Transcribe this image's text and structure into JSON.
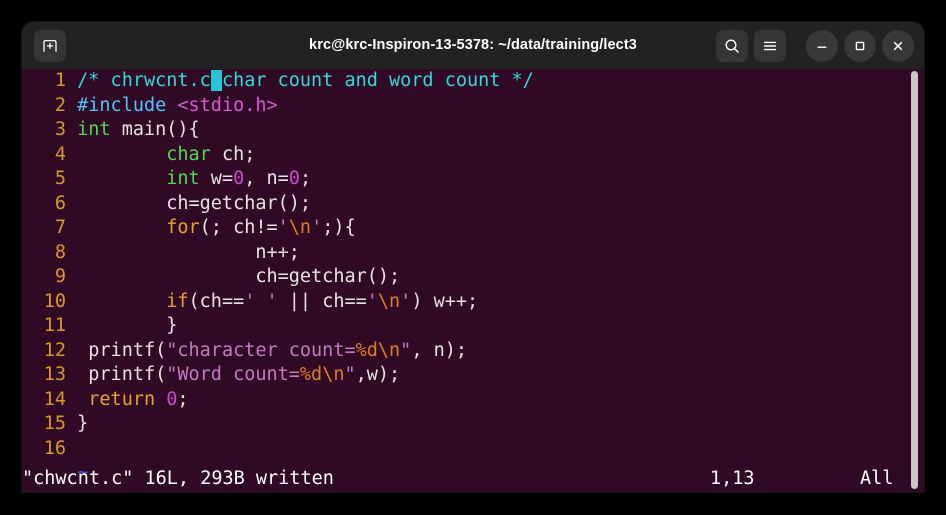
{
  "window": {
    "title": "krc@krc-Inspiron-13-5378: ~/data/training/lect3",
    "background_color": "#300a24",
    "titlebar_color": "#222222"
  },
  "titlebar": {
    "new_tab_label": "new-tab",
    "search_label": "search",
    "menu_label": "menu",
    "minimize_label": "minimize",
    "maximize_label": "maximize",
    "close_label": "close"
  },
  "editor": {
    "lines": [
      {
        "number": "1",
        "spans": [
          {
            "text": "/* chrwcnt.c",
            "class": "c-comment"
          },
          {
            "text": " ",
            "class": "cursor"
          },
          {
            "text": "char count and word count */",
            "class": "c-comment"
          }
        ]
      },
      {
        "number": "2",
        "spans": [
          {
            "text": "#include ",
            "class": "c-preproc"
          },
          {
            "text": "<stdio.h>",
            "class": "c-include"
          }
        ]
      },
      {
        "number": "3",
        "spans": [
          {
            "text": "int",
            "class": "c-type"
          },
          {
            "text": " main(){",
            "class": "c-plain"
          }
        ]
      },
      {
        "number": "4",
        "spans": [
          {
            "text": "        ",
            "class": "c-plain"
          },
          {
            "text": "char",
            "class": "c-type"
          },
          {
            "text": " ch;",
            "class": "c-plain"
          }
        ]
      },
      {
        "number": "5",
        "spans": [
          {
            "text": "        ",
            "class": "c-plain"
          },
          {
            "text": "int",
            "class": "c-type"
          },
          {
            "text": " w=",
            "class": "c-plain"
          },
          {
            "text": "0",
            "class": "c-num"
          },
          {
            "text": ", n=",
            "class": "c-plain"
          },
          {
            "text": "0",
            "class": "c-num"
          },
          {
            "text": ";",
            "class": "c-plain"
          }
        ]
      },
      {
        "number": "6",
        "spans": [
          {
            "text": "        ch=getchar();",
            "class": "c-plain"
          }
        ]
      },
      {
        "number": "7",
        "spans": [
          {
            "text": "        ",
            "class": "c-plain"
          },
          {
            "text": "for",
            "class": "c-kw"
          },
          {
            "text": "(; ch!=",
            "class": "c-plain"
          },
          {
            "text": "'",
            "class": "c-str"
          },
          {
            "text": "\\n",
            "class": "c-esc"
          },
          {
            "text": "'",
            "class": "c-str"
          },
          {
            "text": ";){",
            "class": "c-plain"
          }
        ]
      },
      {
        "number": "8",
        "spans": [
          {
            "text": "                n++;",
            "class": "c-plain"
          }
        ]
      },
      {
        "number": "9",
        "spans": [
          {
            "text": "                ch=getchar();",
            "class": "c-plain"
          }
        ]
      },
      {
        "number": "10",
        "spans": [
          {
            "text": "        ",
            "class": "c-plain"
          },
          {
            "text": "if",
            "class": "c-kw"
          },
          {
            "text": "(ch==",
            "class": "c-plain"
          },
          {
            "text": "' '",
            "class": "c-str"
          },
          {
            "text": " || ch==",
            "class": "c-plain"
          },
          {
            "text": "'",
            "class": "c-str"
          },
          {
            "text": "\\n",
            "class": "c-esc"
          },
          {
            "text": "'",
            "class": "c-str"
          },
          {
            "text": ") w++;",
            "class": "c-plain"
          }
        ]
      },
      {
        "number": "11",
        "spans": [
          {
            "text": "        }",
            "class": "c-plain"
          }
        ]
      },
      {
        "number": "12",
        "spans": [
          {
            "text": " printf(",
            "class": "c-plain"
          },
          {
            "text": "\"character count=",
            "class": "c-str"
          },
          {
            "text": "%d",
            "class": "c-esc"
          },
          {
            "text": "\\n",
            "class": "c-esc"
          },
          {
            "text": "\"",
            "class": "c-str"
          },
          {
            "text": ", n);",
            "class": "c-plain"
          }
        ]
      },
      {
        "number": "13",
        "spans": [
          {
            "text": " printf(",
            "class": "c-plain"
          },
          {
            "text": "\"Word count=",
            "class": "c-str"
          },
          {
            "text": "%d",
            "class": "c-esc"
          },
          {
            "text": "\\n",
            "class": "c-esc"
          },
          {
            "text": "\"",
            "class": "c-str"
          },
          {
            "text": ",w);",
            "class": "c-plain"
          }
        ]
      },
      {
        "number": "14",
        "spans": [
          {
            "text": " ",
            "class": "c-plain"
          },
          {
            "text": "return",
            "class": "c-kw"
          },
          {
            "text": " ",
            "class": "c-plain"
          },
          {
            "text": "0",
            "class": "c-num"
          },
          {
            "text": ";",
            "class": "c-plain"
          }
        ]
      },
      {
        "number": "15",
        "spans": [
          {
            "text": "}",
            "class": "c-plain"
          }
        ]
      },
      {
        "number": "16",
        "spans": []
      },
      {
        "number": "",
        "spans": [
          {
            "text": "~",
            "class": "c-tilde"
          }
        ]
      }
    ]
  },
  "statusline": {
    "message": "\"chwcnt.c\" 16L, 293B written",
    "position": "1,13",
    "scroll": "All"
  }
}
